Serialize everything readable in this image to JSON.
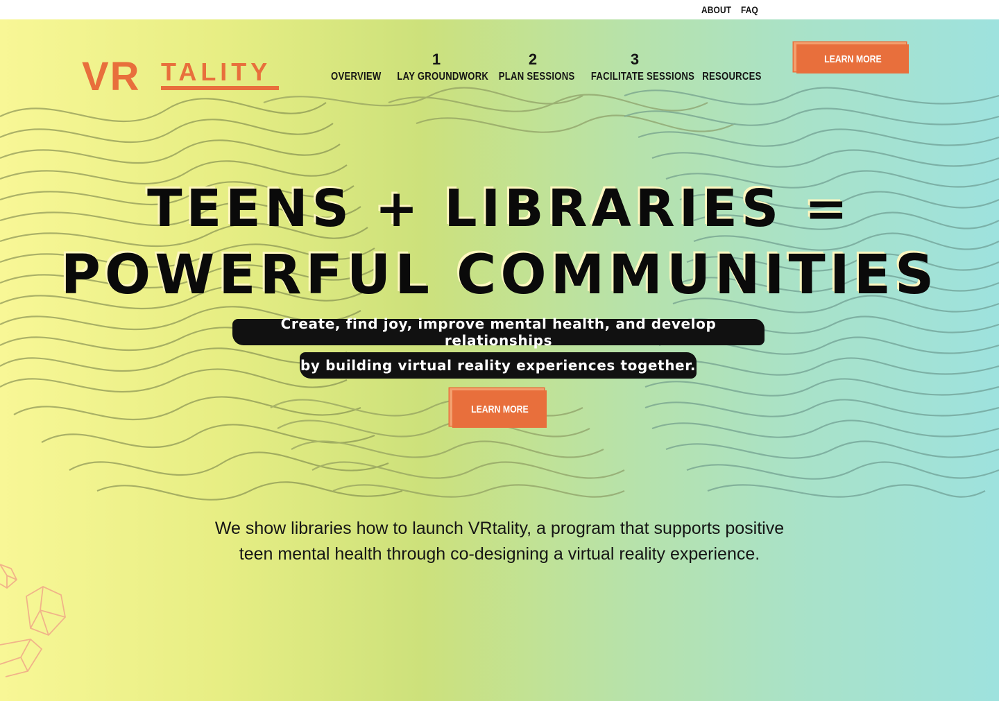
{
  "top_links": {
    "about": "ABOUT",
    "faq": "FAQ"
  },
  "brand": {
    "logo_text_vr": "VR",
    "logo_text_tality": "TALITY",
    "logo_color": "#e86f3c"
  },
  "nav": {
    "items": [
      {
        "number": "",
        "label": "OVERVIEW"
      },
      {
        "number": "1",
        "label": "LAY GROUNDWORK"
      },
      {
        "number": "2",
        "label": "PLAN SESSIONS"
      },
      {
        "number": "3",
        "label": "FACILITATE SESSIONS"
      },
      {
        "number": "",
        "label": "RESOURCES"
      }
    ],
    "cta_label": "LEARN MORE"
  },
  "hero": {
    "headline_line1": "TEENS + LIBRARIES =",
    "headline_line2": "POWERFUL COMMUNITIES",
    "tagline_line1": "Create, find joy, improve mental health, and develop relationships",
    "tagline_line2": "by building virtual reality experiences together.",
    "cta_label": "LEARN MORE"
  },
  "intro": {
    "line1": "We show libraries how to launch VRtality, a program that supports positive",
    "line2": "teen mental health through co-designing a virtual reality experience."
  },
  "colors": {
    "accent": "#e86f3c",
    "gradient_left": "#f8f796",
    "gradient_right": "#9ee2de"
  }
}
